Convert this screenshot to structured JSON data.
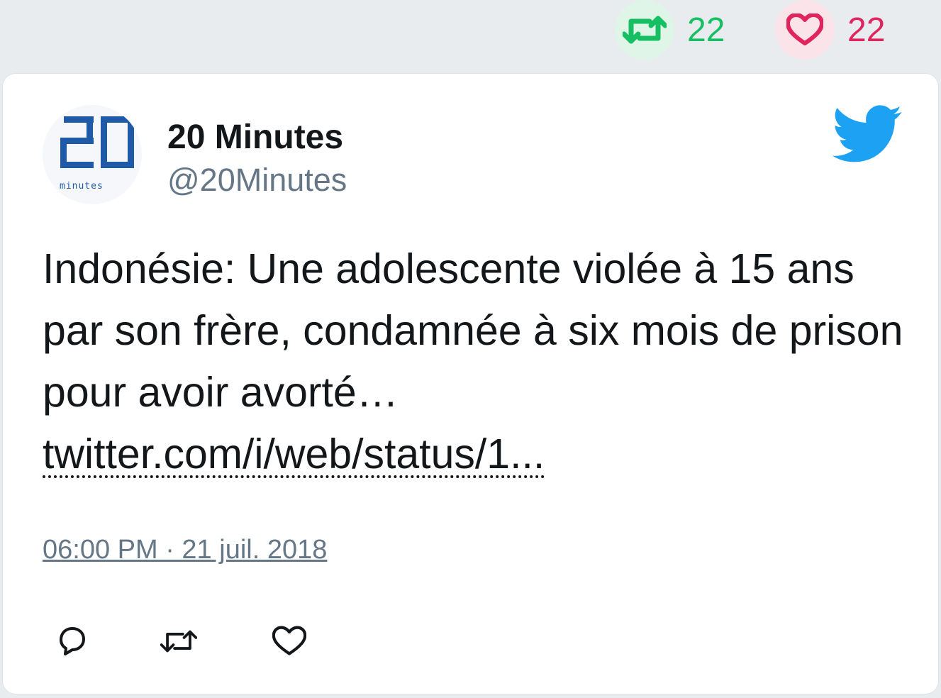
{
  "stats": {
    "retweets": "22",
    "likes": "22",
    "retweet_icon": "retweet-icon",
    "like_icon": "heart-icon",
    "retweet_color": "#17bf63",
    "like_color": "#e0245e"
  },
  "tweet": {
    "author_name": "20 Minutes",
    "author_handle": "@20Minutes",
    "avatar_logo_text": "20 minutes",
    "text": "Indonésie: Une adolescente violée à 15 ans par son frère, condamnée à six mois de prison pour avoir avorté…",
    "link": "twitter.com/i/web/status/1...",
    "timestamp": "06:00 PM · 21 juil. 2018",
    "brand_color": "#1da1f2",
    "platform_icon": "twitter-bird-icon"
  },
  "actions": {
    "reply_icon": "reply-icon",
    "retweet_icon": "retweet-icon",
    "like_icon": "heart-icon"
  }
}
